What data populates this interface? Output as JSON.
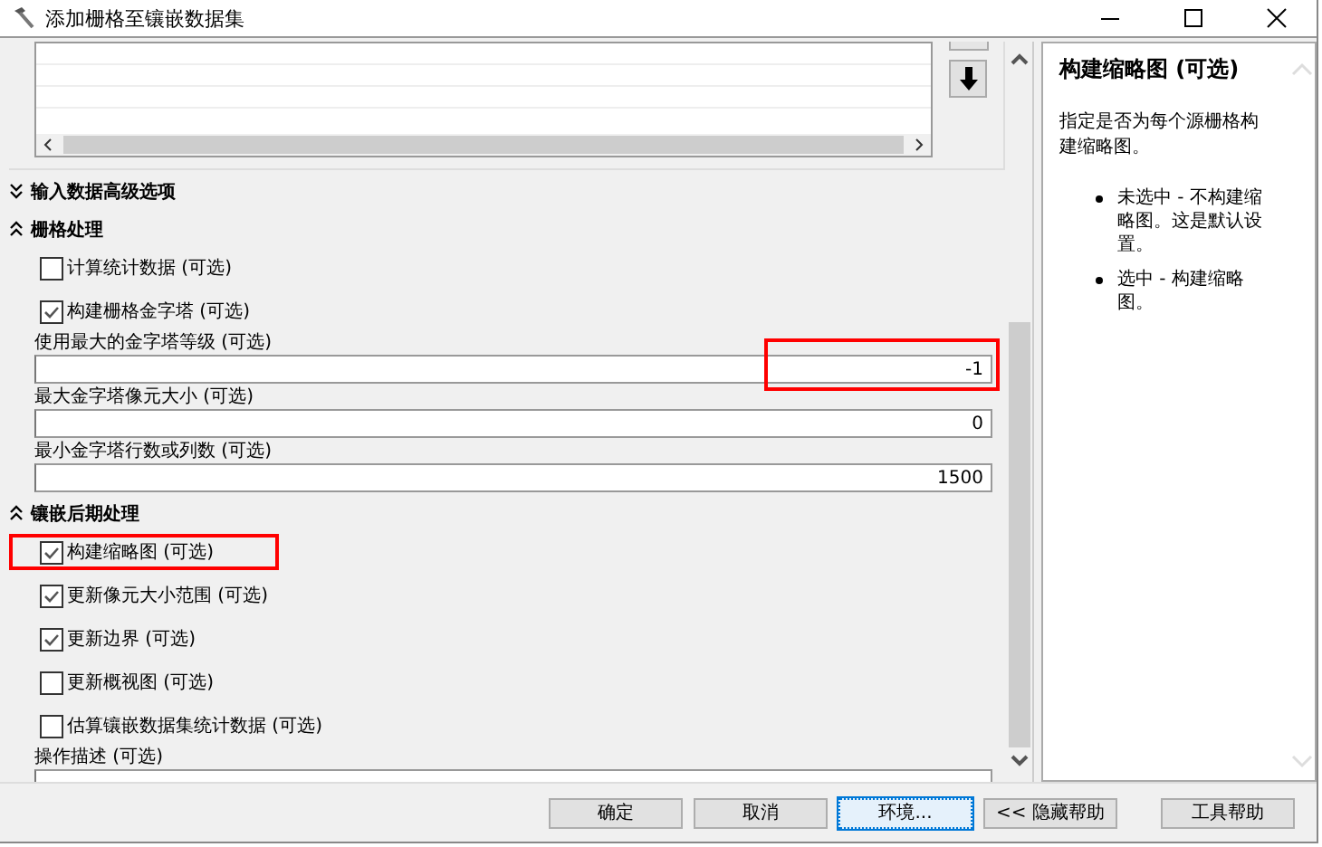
{
  "window": {
    "title": "添加栅格至镶嵌数据集"
  },
  "sections": [
    {
      "title": "输入数据高级选项",
      "expanded": false
    },
    {
      "title": "栅格处理",
      "expanded": true,
      "items": [
        {
          "kind": "checkbox",
          "label": "计算统计数据 (可选)",
          "checked": false,
          "highlighted": false
        },
        {
          "kind": "checkbox",
          "label": "构建栅格金字塔 (可选)",
          "checked": true,
          "highlighted": false
        },
        {
          "kind": "field",
          "label": "使用最大的金字塔等级 (可选)",
          "value": "-1",
          "highlighted": true
        },
        {
          "kind": "field",
          "label": "最大金字塔像元大小 (可选)",
          "value": "0",
          "highlighted": false
        },
        {
          "kind": "field",
          "label": "最小金字塔行数或列数 (可选)",
          "value": "1500",
          "highlighted": false
        }
      ]
    },
    {
      "title": "镶嵌后期处理",
      "expanded": true,
      "items": [
        {
          "kind": "checkbox",
          "label": "构建缩略图 (可选)",
          "checked": true,
          "highlighted": true
        },
        {
          "kind": "checkbox",
          "label": "更新像元大小范围 (可选)",
          "checked": true,
          "highlighted": false
        },
        {
          "kind": "checkbox",
          "label": "更新边界 (可选)",
          "checked": true,
          "highlighted": false
        },
        {
          "kind": "checkbox",
          "label": "更新概视图 (可选)",
          "checked": false,
          "highlighted": false
        },
        {
          "kind": "checkbox",
          "label": "估算镶嵌数据集统计数据 (可选)",
          "checked": false,
          "highlighted": false
        }
      ]
    }
  ],
  "description_field": {
    "label": "操作描述 (可选)"
  },
  "help": {
    "title": "构建缩略图 (可选)",
    "text": "指定是否为每个源栅格构建缩略图。",
    "bullets": [
      "未选中 - 不构建缩略图。这是默认设置。",
      "选中 - 构建缩略图。"
    ]
  },
  "buttons": [
    {
      "label": "确定",
      "focused": false
    },
    {
      "label": "取消",
      "focused": false
    },
    {
      "label": "环境...",
      "focused": true
    },
    {
      "label": "<< 隐藏帮助",
      "focused": false
    },
    {
      "label": "工具帮助",
      "focused": false
    }
  ]
}
